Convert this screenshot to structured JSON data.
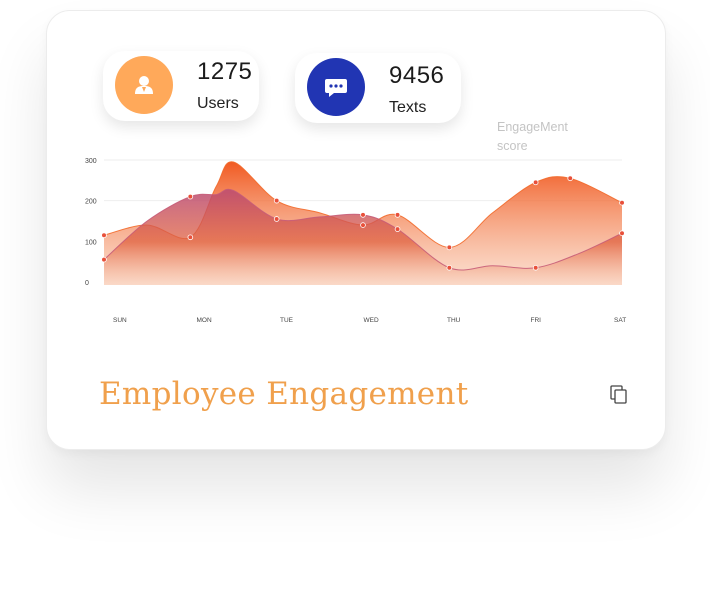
{
  "stats": {
    "users": {
      "value": "1275",
      "label": "Users",
      "icon": "user-icon",
      "color": "#FFA95A"
    },
    "texts": {
      "value": "9456",
      "label": "Texts",
      "icon": "chat-icon",
      "color": "#2135B3"
    }
  },
  "title": "Employee Engagement",
  "colors": {
    "accent": "#F0A04C",
    "series_orange": "#F26A2B",
    "series_rose": "#C65C78"
  },
  "chart_data": {
    "type": "area",
    "categories": [
      "SUN",
      "MON",
      "TUE",
      "WED",
      "THU",
      "FRI",
      "SAT"
    ],
    "y_ticks": [
      "0",
      "100",
      "200",
      "300"
    ],
    "ylim": [
      0,
      300
    ],
    "grid": true,
    "legend_label": "EngageMent score",
    "series": [
      {
        "values": [
          [
            0.0,
            115
          ],
          [
            0.5,
            140
          ],
          [
            1.0,
            110
          ],
          [
            1.3,
            235
          ],
          [
            1.5,
            295
          ],
          [
            2.0,
            200
          ],
          [
            2.5,
            170
          ],
          [
            3.0,
            140
          ],
          [
            3.4,
            165
          ],
          [
            4.0,
            85
          ],
          [
            4.5,
            170
          ],
          [
            5.0,
            245
          ],
          [
            5.4,
            255
          ],
          [
            6.0,
            195
          ]
        ]
      },
      {
        "values": [
          [
            0.0,
            55
          ],
          [
            0.5,
            150
          ],
          [
            1.0,
            210
          ],
          [
            1.3,
            215
          ],
          [
            1.5,
            225
          ],
          [
            2.0,
            155
          ],
          [
            2.5,
            160
          ],
          [
            3.0,
            165
          ],
          [
            3.4,
            130
          ],
          [
            4.0,
            35
          ],
          [
            4.5,
            40
          ],
          [
            5.0,
            35
          ],
          [
            5.5,
            70
          ],
          [
            6.0,
            120
          ]
        ]
      }
    ]
  }
}
